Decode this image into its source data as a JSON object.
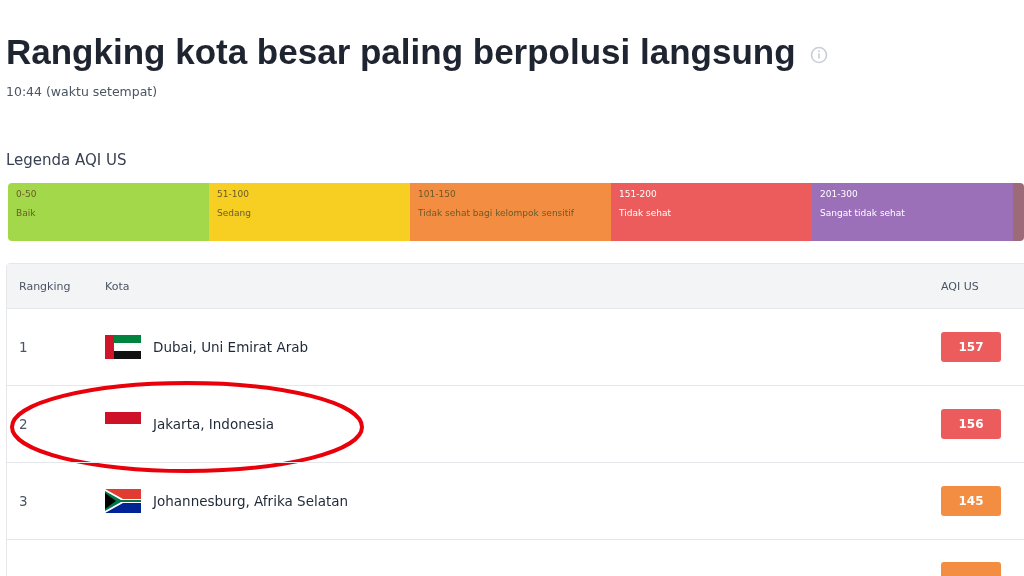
{
  "title": "Rangking kota besar paling berpolusi langsung",
  "time": "10:44 (waktu setempat)",
  "legend": {
    "title": "Legenda AQI US",
    "segments": [
      {
        "range": "0-50",
        "label": "Baik",
        "color": "#a3d84a",
        "dark_text": true
      },
      {
        "range": "51-100",
        "label": "Sedang",
        "color": "#f6cf22",
        "dark_text": true
      },
      {
        "range": "101-150",
        "label": "Tidak sehat bagi kelompok sensitif",
        "color": "#f28d42",
        "dark_text": true
      },
      {
        "range": "151-200",
        "label": "Tidak sehat",
        "color": "#ec5c5c",
        "dark_text": false
      },
      {
        "range": "201-300",
        "label": "Sangat tidak sehat",
        "color": "#9c6fb9",
        "dark_text": false
      },
      {
        "color": "#9c6b7a"
      }
    ]
  },
  "table": {
    "columns": [
      "Rangking",
      "Kota",
      "AQI US"
    ],
    "rows": [
      {
        "rank": "1",
        "city": "Dubai, Uni Emirat Arab",
        "kind": "uae",
        "aqi": "157",
        "color": "#ec5c5c",
        "circled": false
      },
      {
        "rank": "2",
        "city": "Jakarta, Indonesia",
        "kind": "indonesia",
        "aqi": "156",
        "color": "#ec5c5c",
        "circled": true
      },
      {
        "rank": "3",
        "city": "Johannesburg, Afrika Selatan",
        "kind": "south-africa",
        "aqi": "145",
        "color": "#f28d42",
        "circled": false
      },
      {
        "color": "#f28d42",
        "circled": false
      }
    ]
  }
}
